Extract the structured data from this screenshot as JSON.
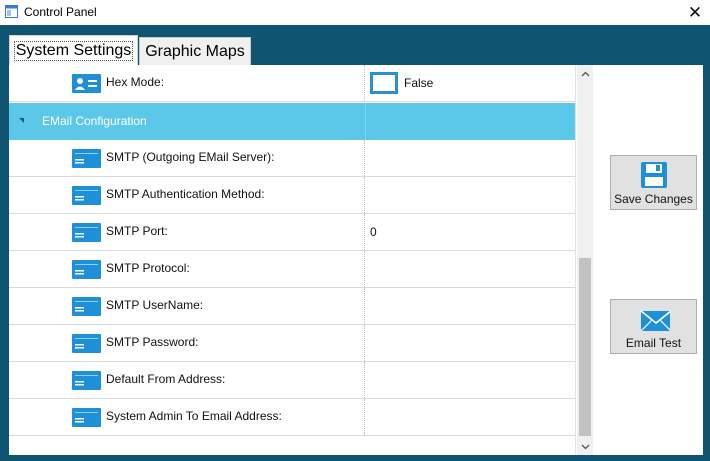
{
  "window": {
    "title": "Control Panel",
    "close_glyph": "✕"
  },
  "tabs": [
    {
      "label": "System Settings",
      "active": true
    },
    {
      "label": "Graphic Maps",
      "active": false
    }
  ],
  "grid": {
    "hex_mode": {
      "label": "Hex Mode:",
      "value": "False",
      "icon": "person-card-icon"
    },
    "section": {
      "label": "EMail Configuration",
      "expanded": true
    },
    "rows": [
      {
        "label": "SMTP (Outgoing EMail Server):",
        "value": "",
        "icon": "text-field-icon"
      },
      {
        "label": "SMTP Authentication Method:",
        "value": "",
        "icon": "text-field-icon"
      },
      {
        "label": "SMTP Port:",
        "value": "0",
        "icon": "text-field-icon"
      },
      {
        "label": "SMTP Protocol:",
        "value": "",
        "icon": "text-field-icon"
      },
      {
        "label": "SMTP UserName:",
        "value": "",
        "icon": "text-field-icon"
      },
      {
        "label": "SMTP Password:",
        "value": "",
        "icon": "text-field-icon"
      },
      {
        "label": "Default From Address:",
        "value": "",
        "icon": "text-field-icon"
      },
      {
        "label": "System Admin To Email Address:",
        "value": "",
        "icon": "text-field-icon"
      }
    ]
  },
  "buttons": {
    "save": {
      "label": "Save Changes",
      "icon": "floppy-disk-icon"
    },
    "email_test": {
      "label": "Email Test",
      "icon": "envelope-icon"
    }
  },
  "colors": {
    "frame": "#0f5572",
    "section_header": "#5bc8ea",
    "icon_blue": "#1e90d8"
  }
}
